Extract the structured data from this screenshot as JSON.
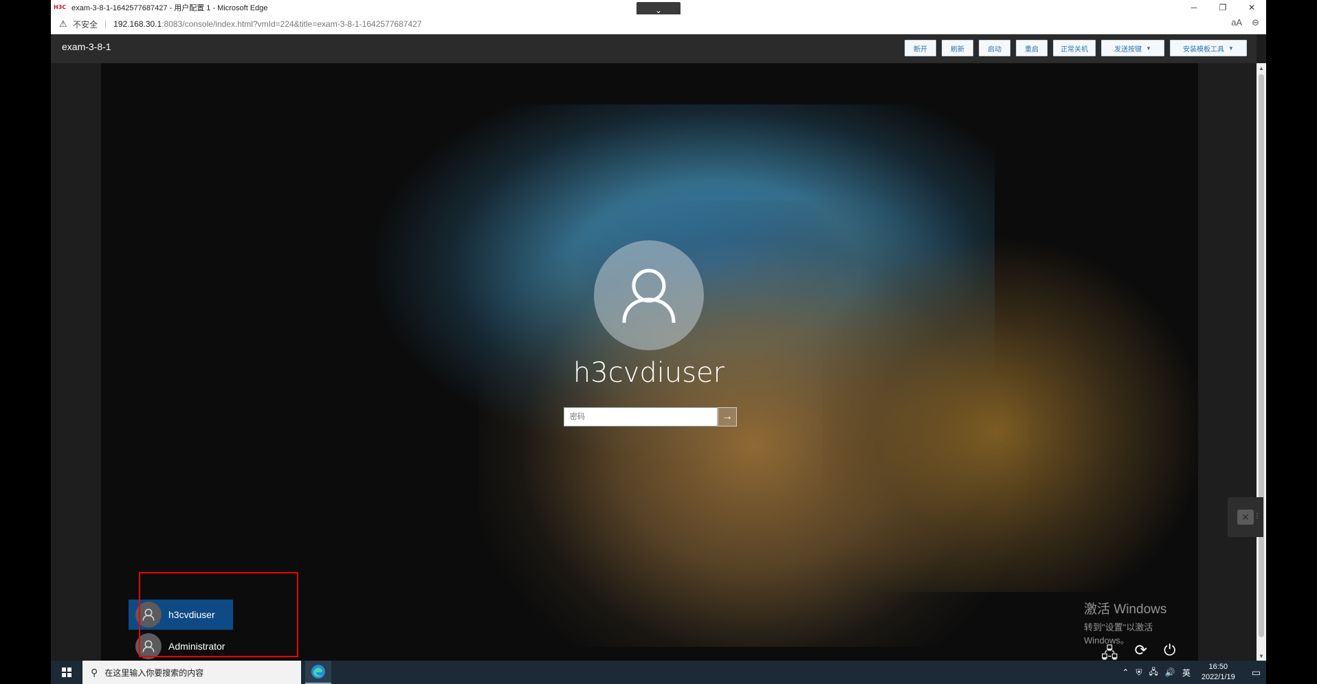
{
  "browser": {
    "window_title": "exam-3-8-1-1642577687427 - 用户配置 1 - Microsoft Edge",
    "logo_text": "H3C",
    "collapse_icon": "chevron-down-icon",
    "insecure_label": "不安全",
    "url_main": "192.168.30.1",
    "url_rest": ":8083/console/index.html?vmId=224&title=exam-3-8-1-1642577687427",
    "read_aloud_icon": "aA",
    "zoom_icon": "zoom-icon"
  },
  "console": {
    "vm_name": "exam-3-8-1",
    "buttons": {
      "disconnect": "断开",
      "refresh": "刷新",
      "start": "启动",
      "restart": "重启",
      "shutdown": "正常关机",
      "send_keys": "发送按键",
      "install_tools": "安装模板工具"
    }
  },
  "login": {
    "username": "h3cvdiuser",
    "password_placeholder": "密码",
    "submit_icon": "→"
  },
  "user_switcher": {
    "users": [
      {
        "name": "h3cvdiuser",
        "active": true
      },
      {
        "name": "Administrator",
        "active": false
      }
    ]
  },
  "activation": {
    "line1": "激活 Windows",
    "line2": "转到\"设置\"以激活 Windows。"
  },
  "taskbar": {
    "search_placeholder": "在这里输入你要搜索的内容",
    "ime": "英",
    "time": "16:50",
    "date": "2022/1/19"
  },
  "colors": {
    "active_user_bg": "#0e4a85",
    "highlight_border": "#ee0000",
    "console_button_text": "#2b74b8"
  }
}
